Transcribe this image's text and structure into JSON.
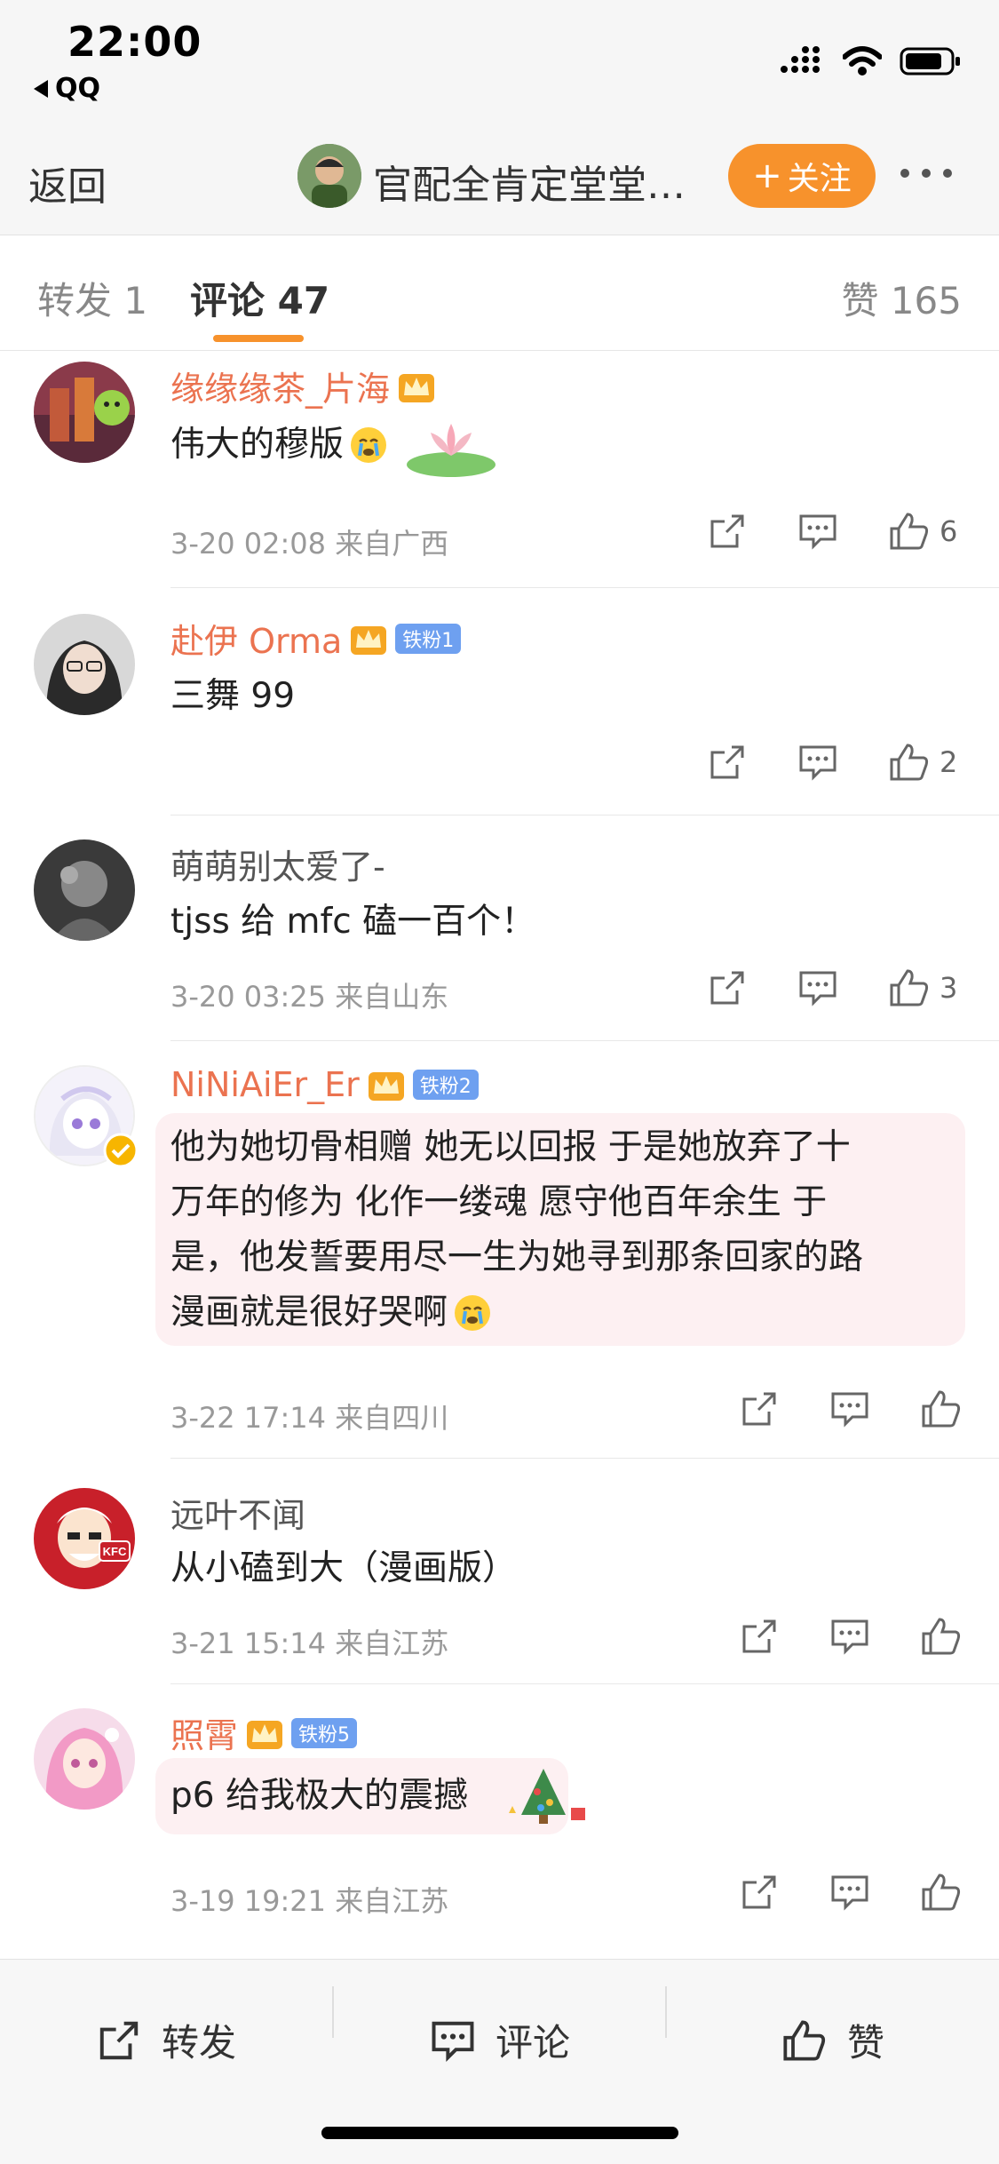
{
  "status_bar": {
    "time": "22:00",
    "back_app": "QQ"
  },
  "nav": {
    "back_label": "返回",
    "title": "官配全肯定堂堂…",
    "follow_label": "关注"
  },
  "tabs": [
    {
      "label": "转发 1"
    },
    {
      "label": "评论 47"
    },
    {
      "label": "赞 165"
    }
  ],
  "comments": [
    {
      "username": "缘缘缘茶_片海",
      "content": "伟大的穆版",
      "meta": "3-20 02:08 来自广西",
      "like_count": "6",
      "badge": ""
    },
    {
      "username": "赴伊 Orma",
      "content": "三舞 99",
      "meta": "",
      "like_count": "2",
      "badge": "铁粉1"
    },
    {
      "username": "萌萌别太爱了-",
      "content": "tjss 给 mfc 磕一百个！",
      "meta": "3-20 03:25 来自山东",
      "like_count": "3",
      "badge": ""
    },
    {
      "username": "NiNiAiEr_Er",
      "content_lines": [
        "他为她切骨相赠 她无以回报 于是她放弃了十",
        "万年的修为 化作一缕魂 愿守他百年余生 于",
        "是，他发誓要用尽一生为她寻到那条回家的路",
        "漫画就是很好哭啊"
      ],
      "meta": "3-22 17:14 来自四川",
      "like_count": "",
      "badge": "铁粉2"
    },
    {
      "username": "远叶不闻",
      "content": "从小磕到大（漫画版）",
      "meta": "3-21 15:14 来自江苏",
      "like_count": "",
      "badge": ""
    },
    {
      "username": "照霄",
      "content": "p6 给我极大的震撼",
      "meta": "3-19 19:21 来自江苏",
      "like_count": "",
      "badge": "铁粉5"
    }
  ],
  "toolbar": {
    "repost_label": "转发",
    "comment_label": "评论",
    "like_label": "赞"
  },
  "colors": {
    "accent_orange": "#f7922c",
    "username_orange": "#eb7350",
    "badge_blue": "#6ea0f0"
  },
  "icons": [
    "share-icon",
    "comment-icon",
    "like-icon",
    "crown-icon",
    "verified-icon",
    "wifi-icon",
    "signal-icon",
    "battery-icon"
  ]
}
